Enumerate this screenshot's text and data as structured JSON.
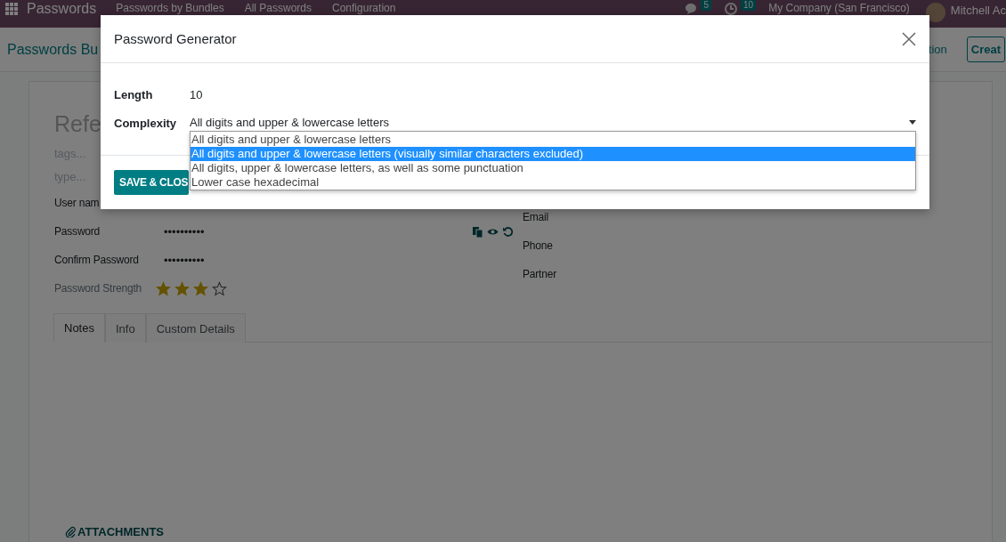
{
  "navbar": {
    "app_name": "Passwords",
    "menu": [
      "Passwords by Bundles",
      "All Passwords",
      "Configuration"
    ],
    "messages_badge": "5",
    "activities_badge": "10",
    "company": "My Company (San Francisco)",
    "user": "Mitchell Ac"
  },
  "control_panel": {
    "breadcrumb": "Passwords Bu",
    "buttons": [
      {
        "label": "tion",
        "kind": "link"
      },
      {
        "label": "Creat",
        "kind": "outline"
      }
    ]
  },
  "form": {
    "title_placeholder": "Refe",
    "tags_placeholder": "tags...",
    "type_placeholder": "type...",
    "left_fields": [
      {
        "label": "User nam",
        "kind": "text"
      },
      {
        "label": "Password",
        "value": "••••••••••",
        "kind": "password"
      },
      {
        "label": "Confirm Password",
        "value": "••••••••••",
        "kind": "text"
      }
    ],
    "strength": {
      "label": "Password Strength",
      "stars": 3
    },
    "right_fields": [
      {
        "label": "Email"
      },
      {
        "label": "Phone"
      },
      {
        "label": "Partner"
      }
    ],
    "tabs": [
      {
        "label": "Notes",
        "selected": true
      },
      {
        "label": "Info",
        "selected": false
      },
      {
        "label": "Custom Details",
        "selected": false
      }
    ],
    "attachments": "ATTACHMENTS"
  },
  "modal": {
    "title": "Password Generator",
    "fields": [
      {
        "label": "Length",
        "value": "10",
        "kind": "text"
      },
      {
        "label": "Complexity",
        "value": "All digits and upper & lowercase letters",
        "kind": "select"
      }
    ],
    "options": [
      {
        "label": "All digits and upper & lowercase letters",
        "selected": false
      },
      {
        "label": "All digits and upper & lowercase letters (visually similar characters excluded)",
        "selected": true
      },
      {
        "label": "All digits, upper & lowercase letters, as well as some punctuation",
        "selected": false
      },
      {
        "label": "Lower case hexadecimal",
        "selected": false
      }
    ],
    "save_button": "SAVE & CLOS"
  }
}
